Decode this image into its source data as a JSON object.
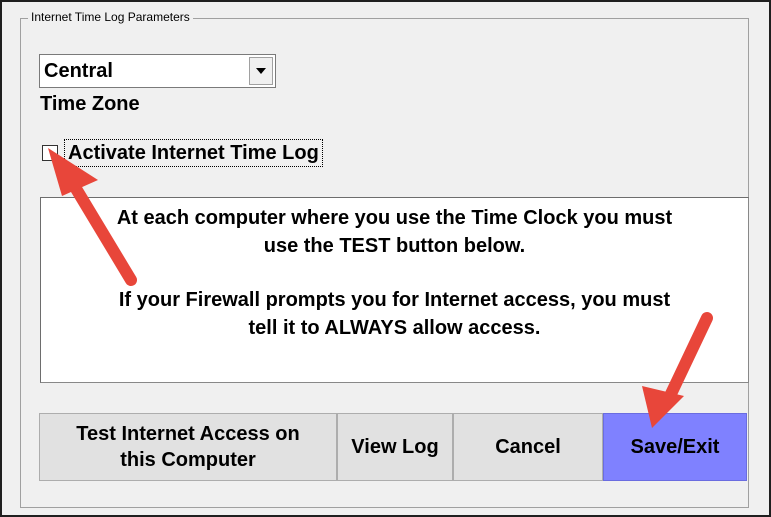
{
  "group": {
    "title": "Internet Time Log Parameters"
  },
  "timezone": {
    "selected": "Central",
    "label": "Time Zone"
  },
  "activate": {
    "label": "Activate Internet Time Log",
    "checked": false
  },
  "info": {
    "line1": "At each computer where you use the Time Clock you must",
    "line2": "use the TEST button below.",
    "line3": "If your Firewall prompts you for Internet access, you must",
    "line4": "tell it to ALWAYS allow access."
  },
  "buttons": {
    "test_line1": "Test Internet Access on",
    "test_line2": "this Computer",
    "view_log": "View Log",
    "cancel": "Cancel",
    "save_exit": "Save/Exit"
  },
  "colors": {
    "save_button_bg": "#7f81ff",
    "annotation_arrow": "#e8463a"
  },
  "icons": {
    "dropdown": "chevron-down-icon",
    "annotation": "arrow-icon"
  }
}
